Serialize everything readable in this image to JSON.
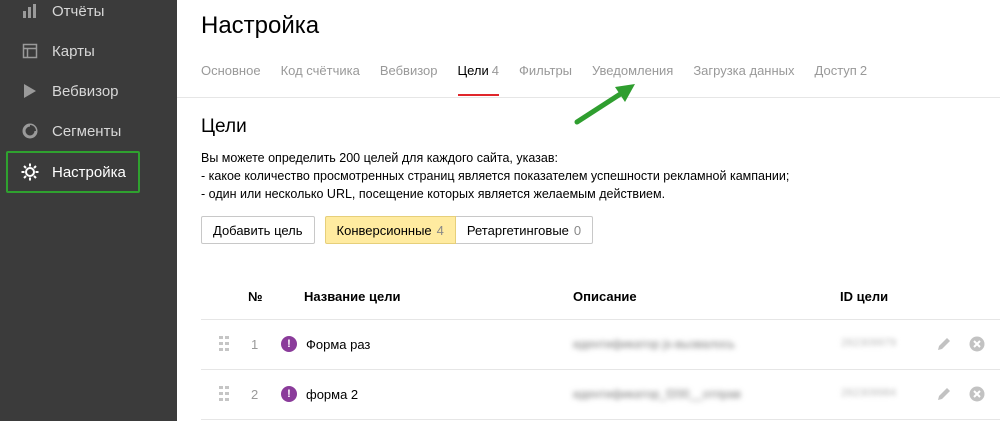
{
  "sidebar": {
    "items": [
      {
        "label": "Отчёты",
        "icon": "bar-chart-icon"
      },
      {
        "label": "Карты",
        "icon": "map-icon"
      },
      {
        "label": "Вебвизор",
        "icon": "play-icon"
      },
      {
        "label": "Сегменты",
        "icon": "segments-icon"
      },
      {
        "label": "Настройка",
        "icon": "gear-icon",
        "active": true
      }
    ]
  },
  "header": {
    "title": "Настройка"
  },
  "tabs": [
    {
      "label": "Основное",
      "count": ""
    },
    {
      "label": "Код счётчика",
      "count": ""
    },
    {
      "label": "Вебвизор",
      "count": ""
    },
    {
      "label": "Цели",
      "count": "4",
      "active": true
    },
    {
      "label": "Фильтры",
      "count": ""
    },
    {
      "label": "Уведомления",
      "count": ""
    },
    {
      "label": "Загрузка данных",
      "count": ""
    },
    {
      "label": "Доступ",
      "count": "2"
    }
  ],
  "goals": {
    "title": "Цели",
    "description": [
      "Вы можете определить 200 целей для каждого сайта, указав:",
      "- какое количество просмотренных страниц является показателем успешности рекламной кампании;",
      "- один или несколько URL, посещение которых является желаемым действием."
    ],
    "add_button": "Добавить цель",
    "filters": [
      {
        "label": "Конверсионные",
        "count": "4",
        "active": true
      },
      {
        "label": "Ретаргетинговые",
        "count": "0"
      }
    ],
    "columns": {
      "num": "№",
      "name": "Название цели",
      "description": "Описание",
      "id": "ID цели"
    },
    "rows": [
      {
        "num": "1",
        "name": "Форма раз",
        "description": "идентификатор js-вызвалось",
        "id": "262309979"
      },
      {
        "num": "2",
        "name": "форма 2",
        "description": "идентификатор_f200__отправ",
        "id": "262309984"
      }
    ]
  },
  "colors": {
    "sidebar_bg": "#3b3b3b",
    "active_tab_underline": "#e0262b",
    "highlight_box": "#2fa12f",
    "active_filter_bg": "#ffeba0",
    "warning_badge": "#8a3b9a"
  }
}
